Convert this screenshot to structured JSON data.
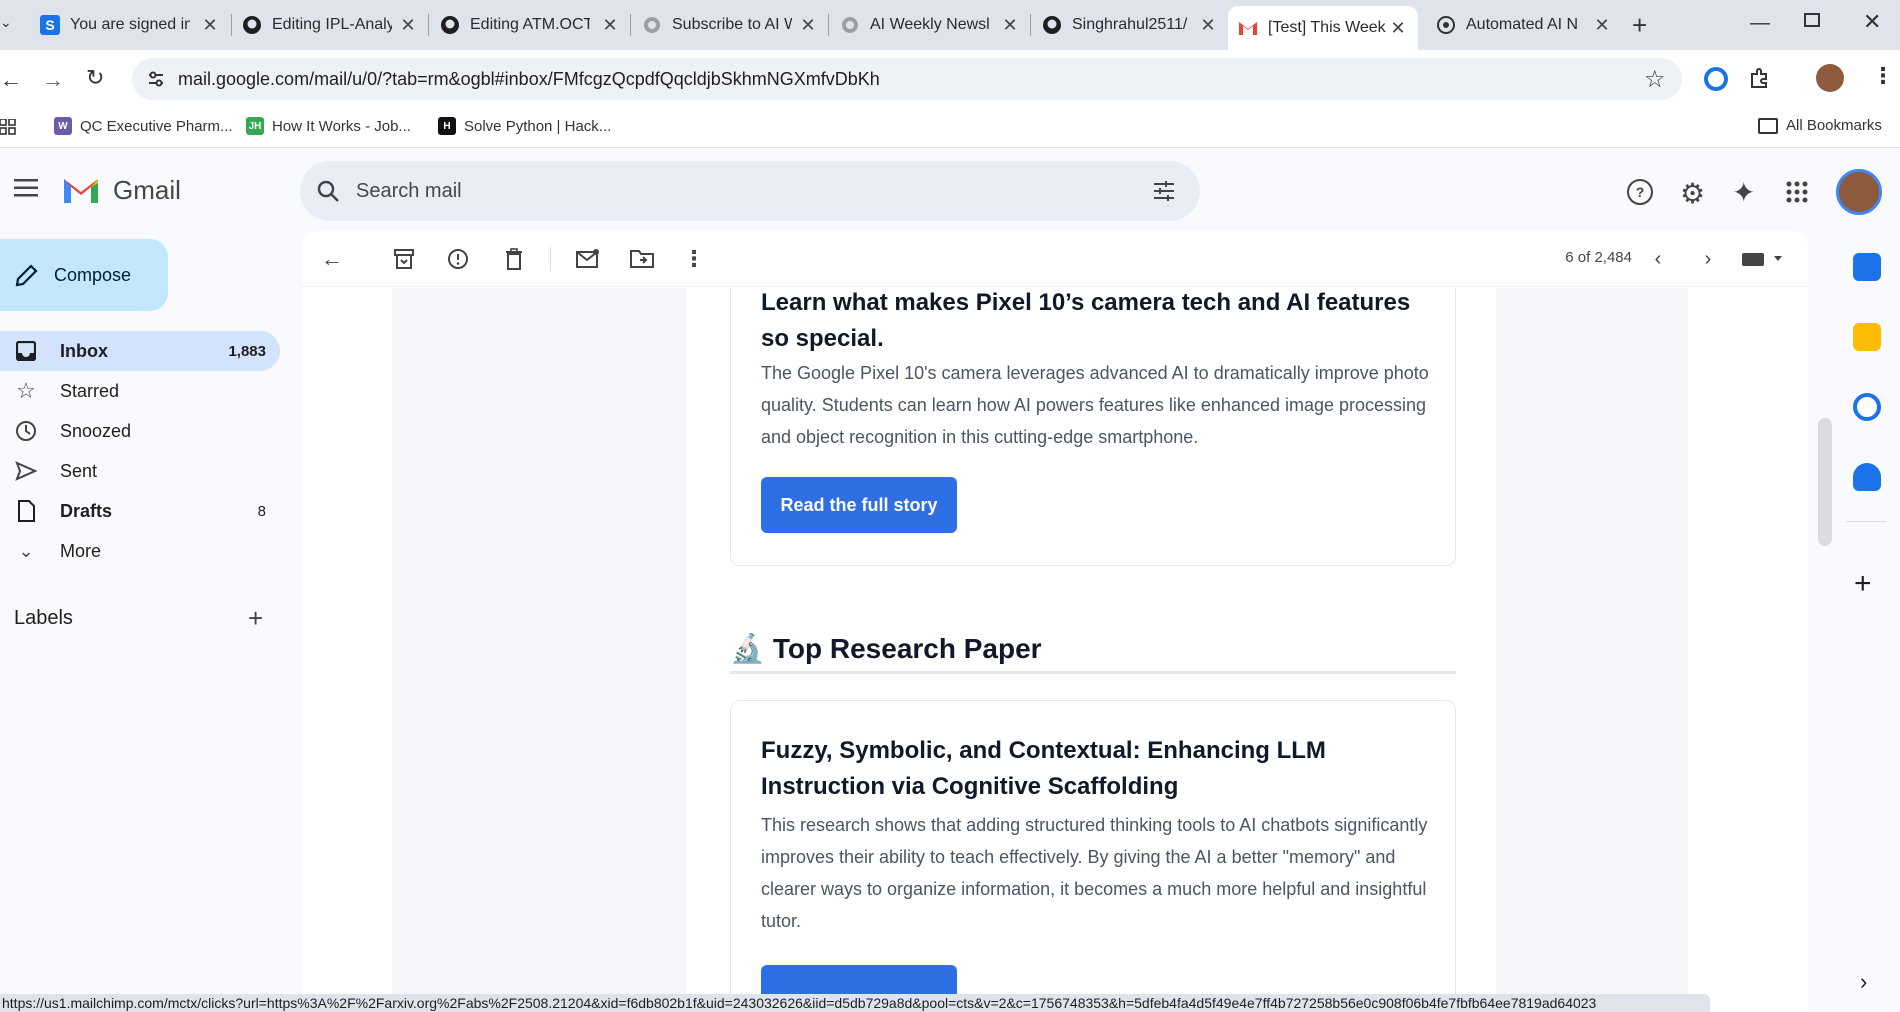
{
  "browser": {
    "tabs": [
      {
        "title": "You are signed in",
        "icon": "s-square-icon"
      },
      {
        "title": "Editing IPL-Analy",
        "icon": "github-icon"
      },
      {
        "title": "Editing ATM.OCT",
        "icon": "github-icon"
      },
      {
        "title": "Subscribe to AI W",
        "icon": "globe-icon"
      },
      {
        "title": "AI Weekly Newsl",
        "icon": "globe-icon"
      },
      {
        "title": "Singhrahul2511/",
        "icon": "github-icon"
      },
      {
        "title": "[Test] This Week",
        "icon": "gmail-icon",
        "active": true
      },
      {
        "title": "Automated AI N",
        "icon": "openai-icon"
      }
    ],
    "url": "mail.google.com/mail/u/0/?tab=rm&ogbl#inbox/FMfcgzQcpdfQqcldjbSkhmNGXmfvDbKh",
    "bookmarks": [
      {
        "label": "QC Executive Pharm...",
        "icon": "W"
      },
      {
        "label": "How It Works - Job...",
        "icon": "JH"
      },
      {
        "label": "Solve Python | Hack...",
        "icon": "H"
      }
    ],
    "all_bookmarks": "All Bookmarks",
    "status_url": "https://us1.mailchimp.com/mctx/clicks?url=https%3A%2F%2Farxiv.org%2Fabs%2F2508.21204&xid=f6db802b1f&uid=243032626&iid=d5db729a8d&pool=cts&v=2&c=1756748353&h=5dfeb4fa4d5f49e4e7ff4b727258b56e0c908f06b4fe7fbfb64ee7819ad64023"
  },
  "gmail": {
    "logo": "Gmail",
    "search_placeholder": "Search mail",
    "compose": "Compose",
    "nav": [
      {
        "label": "Inbox",
        "count": "1,883",
        "icon": "inbox-icon",
        "active": true
      },
      {
        "label": "Starred",
        "count": "",
        "icon": "star-icon"
      },
      {
        "label": "Snoozed",
        "count": "",
        "icon": "clock-icon"
      },
      {
        "label": "Sent",
        "count": "",
        "icon": "send-icon"
      },
      {
        "label": "Drafts",
        "count": "8",
        "icon": "draft-icon",
        "bold": true
      },
      {
        "label": "More",
        "count": "",
        "icon": "chevron-down-icon"
      }
    ],
    "labels_title": "Labels",
    "pager": "6 of 2,484"
  },
  "email": {
    "card1": {
      "title": "Learn what makes Pixel 10’s camera tech and AI features so special.",
      "body": "The Google Pixel 10's camera leverages advanced AI to dramatically improve photo quality. Students can learn how AI powers features like enhanced image processing and object recognition in this cutting-edge smartphone.",
      "button": "Read the full story"
    },
    "section_emoji": "🔬",
    "section_title": "Top Research Paper",
    "card2": {
      "title": "Fuzzy, Symbolic, and Contextual: Enhancing LLM Instruction via Cognitive Scaffolding",
      "body": "This research shows that adding structured thinking tools to AI chatbots significantly improves their ability to teach effectively. By giving the AI a better \"memory\" and clearer ways to organize information, it becomes a much more helpful and insightful tutor."
    }
  },
  "colors": {
    "accent": "#2f6fe4",
    "compose_bg": "#c2e7ff",
    "active_nav": "#d3e3fd"
  }
}
